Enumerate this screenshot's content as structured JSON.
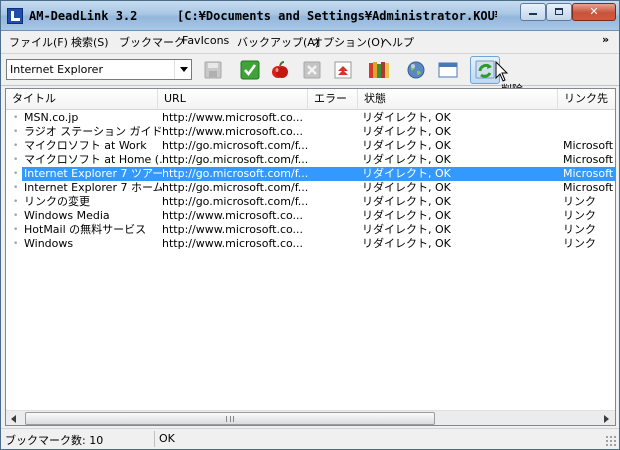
{
  "window": {
    "app_title": "AM-DeadLink 3.2",
    "path_title": "[C:¥Documents and Settings¥Administrator.KOU¥F..."
  },
  "menu": {
    "items": [
      "ファイル(F)",
      "検索(S)",
      "ブックマーク",
      "FavIcons",
      "バックアップ(A)",
      "オプション(O)",
      "ヘルプ"
    ],
    "more": "»"
  },
  "toolbar": {
    "browser_value": "Internet Explorer",
    "tooltip": "削除"
  },
  "list": {
    "columns": [
      "タイトル",
      "URL",
      "エラー",
      "状態",
      "リンク先"
    ],
    "rows": [
      {
        "title": "MSN.co.jp",
        "url": "http://www.microsoft.co...",
        "error": "",
        "status": "リダイレクト, OK",
        "link": ""
      },
      {
        "title": "ラジオ ステーション ガイド",
        "url": "http://www.microsoft.co...",
        "error": "",
        "status": "リダイレクト, OK",
        "link": ""
      },
      {
        "title": "マイクロソフト at Work",
        "url": "http://go.microsoft.com/f...",
        "error": "",
        "status": "リダイレクト, OK",
        "link": "Microsoft の"
      },
      {
        "title": "マイクロソフト at Home (...",
        "url": "http://go.microsoft.com/f...",
        "error": "",
        "status": "リダイレクト, OK",
        "link": "Microsoft の"
      },
      {
        "title": "Internet Explorer 7 ツアー",
        "url": "http://go.microsoft.com/f...",
        "error": "",
        "status": "リダイレクト, OK",
        "link": "Microsoft の"
      },
      {
        "title": "Internet Explorer 7 ホーム",
        "url": "http://go.microsoft.com/f...",
        "error": "",
        "status": "リダイレクト, OK",
        "link": "Microsoft の"
      },
      {
        "title": "リンクの変更",
        "url": "http://go.microsoft.com/f...",
        "error": "",
        "status": "リダイレクト, OK",
        "link": "リンク"
      },
      {
        "title": "Windows Media",
        "url": "http://www.microsoft.co...",
        "error": "",
        "status": "リダイレクト, OK",
        "link": "リンク"
      },
      {
        "title": "HotMail の無料サービス",
        "url": "http://www.microsoft.co...",
        "error": "",
        "status": "リダイレクト, OK",
        "link": "リンク"
      },
      {
        "title": "Windows",
        "url": "http://www.microsoft.co...",
        "error": "",
        "status": "リダイレクト, OK",
        "link": "リンク"
      }
    ],
    "selected_index": 4
  },
  "statusbar": {
    "count": "ブックマーク数: 10",
    "message": "OK"
  },
  "colors": {
    "selection": "#3399ff",
    "titlebar": "#a8c6e4"
  }
}
